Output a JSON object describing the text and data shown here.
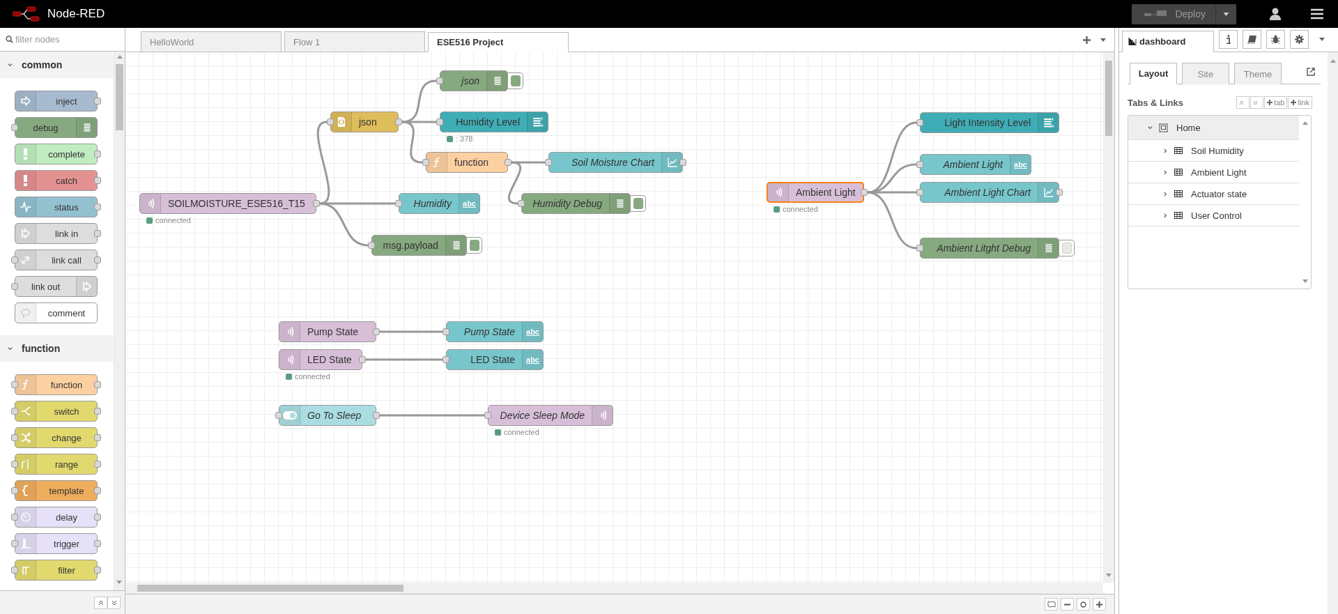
{
  "header": {
    "title": "Node-RED",
    "deploy": "Deploy"
  },
  "palette": {
    "filter_placeholder": "filter nodes",
    "categories": [
      {
        "name": "common",
        "expanded": true,
        "nodes": [
          {
            "label": "inject",
            "kind": "inject"
          },
          {
            "label": "debug",
            "kind": "debug"
          },
          {
            "label": "complete",
            "kind": "complete"
          },
          {
            "label": "catch",
            "kind": "catch"
          },
          {
            "label": "status",
            "kind": "status"
          },
          {
            "label": "link in",
            "kind": "link-in"
          },
          {
            "label": "link call",
            "kind": "link-call"
          },
          {
            "label": "link out",
            "kind": "link-out"
          },
          {
            "label": "comment",
            "kind": "comment"
          }
        ]
      },
      {
        "name": "function",
        "expanded": true,
        "nodes": [
          {
            "label": "function",
            "kind": "function"
          },
          {
            "label": "switch",
            "kind": "switch"
          },
          {
            "label": "change",
            "kind": "change"
          },
          {
            "label": "range",
            "kind": "range"
          },
          {
            "label": "template",
            "kind": "template"
          },
          {
            "label": "delay",
            "kind": "delay"
          },
          {
            "label": "trigger",
            "kind": "trigger"
          },
          {
            "label": "filter",
            "kind": "filter"
          }
        ]
      }
    ]
  },
  "workspace_tabs": [
    {
      "label": "HelloWorld",
      "selected": false
    },
    {
      "label": "Flow 1",
      "selected": false
    },
    {
      "label": "ESE516 Project",
      "selected": true
    }
  ],
  "flow": {
    "nodes": [
      {
        "label": "json",
        "kind": "debug",
        "italic": true,
        "selected": false,
        "active": true
      },
      {
        "label": "json",
        "kind": "json",
        "italic": false,
        "selected": false
      },
      {
        "label": "Humidity Level",
        "kind": "ui-gauge",
        "italic": false,
        "selected": false,
        "status": ": 378"
      },
      {
        "label": "function",
        "kind": "function",
        "italic": false,
        "selected": false
      },
      {
        "label": "Soil Moisture Chart",
        "kind": "ui-chart",
        "italic": true,
        "selected": false
      },
      {
        "label": "Light Intensity Level",
        "kind": "ui-gauge",
        "italic": false,
        "selected": false
      },
      {
        "label": "Ambient Light",
        "kind": "ui-text",
        "italic": true,
        "selected": false,
        "badge": "abc"
      },
      {
        "label": "Ambient Light",
        "kind": "mqtt-in",
        "italic": false,
        "selected": true,
        "status": "connected"
      },
      {
        "label": "Ambient Light Chart",
        "kind": "ui-chart",
        "italic": true,
        "selected": false
      },
      {
        "label": "SOILMOISTURE_ESE516_T15",
        "kind": "mqtt-in",
        "italic": false,
        "selected": false,
        "status": "connected"
      },
      {
        "label": "Humidity",
        "kind": "ui-text",
        "italic": true,
        "selected": false,
        "badge": "abc"
      },
      {
        "label": "Humidity Debug",
        "kind": "debug",
        "italic": true,
        "selected": false,
        "active": true
      },
      {
        "label": "msg.payload",
        "kind": "debug",
        "italic": false,
        "selected": false,
        "active": true
      },
      {
        "label": "Ambient Litght Debug",
        "kind": "debug",
        "italic": true,
        "selected": false,
        "active": false
      },
      {
        "label": "Pump State",
        "kind": "mqtt-in",
        "italic": false,
        "selected": false
      },
      {
        "label": "Pump State",
        "kind": "ui-text",
        "italic": true,
        "selected": false,
        "badge": "abc"
      },
      {
        "label": "LED State",
        "kind": "mqtt-in",
        "italic": false,
        "selected": false,
        "status": "connected"
      },
      {
        "label": "LED State",
        "kind": "ui-text",
        "italic": false,
        "selected": false,
        "badge": "abc"
      },
      {
        "label": "Go To Sleep",
        "kind": "ui-switch",
        "italic": true,
        "selected": false
      },
      {
        "label": "Device Sleep Mode",
        "kind": "mqtt-out",
        "italic": true,
        "selected": false,
        "status": "connected"
      }
    ]
  },
  "sidebar": {
    "tabs": [
      {
        "label": "dashboard",
        "selected": true
      }
    ],
    "subtabs": [
      {
        "label": "Layout",
        "selected": true
      },
      {
        "label": "Site",
        "selected": false
      },
      {
        "label": "Theme",
        "selected": false
      }
    ],
    "section_title": "Tabs & Links",
    "add_buttons": [
      "tab",
      "link"
    ],
    "tree": [
      {
        "label": "Home",
        "expanded": true,
        "children": [
          {
            "label": "Soil Humidity",
            "expanded": false
          },
          {
            "label": "Ambient Light",
            "expanded": false
          },
          {
            "label": "Actuator state",
            "expanded": false
          },
          {
            "label": "User Control",
            "expanded": false
          }
        ]
      }
    ]
  }
}
